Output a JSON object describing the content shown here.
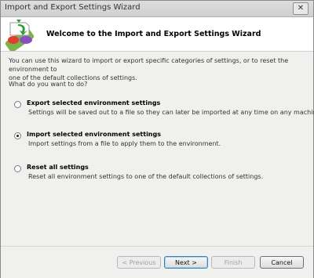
{
  "window": {
    "title": "Import and Export Settings Wizard",
    "close_label": "✕"
  },
  "header": {
    "title": "Welcome to the Import and Export Settings Wizard"
  },
  "content": {
    "intro_line1": "You can use this wizard to import or export specific categories of settings, or to reset the environment to",
    "intro_line2": "one of the default collections of settings.",
    "question": "What do you want to do?",
    "options": [
      {
        "label": "Export selected environment settings",
        "description": "Settings will be saved out to a file so they can later be imported at any time on any machine.",
        "selected": false
      },
      {
        "label": "Import selected environment settings",
        "description": "Import settings from a file to apply them to the environment.",
        "selected": true
      },
      {
        "label": "Reset all settings",
        "description": "Reset all environment settings to one of the default collections of settings.",
        "selected": false
      }
    ]
  },
  "footer": {
    "previous_label": "< Previous",
    "next_label": "Next >",
    "finish_label": "Finish",
    "cancel_label": "Cancel"
  }
}
